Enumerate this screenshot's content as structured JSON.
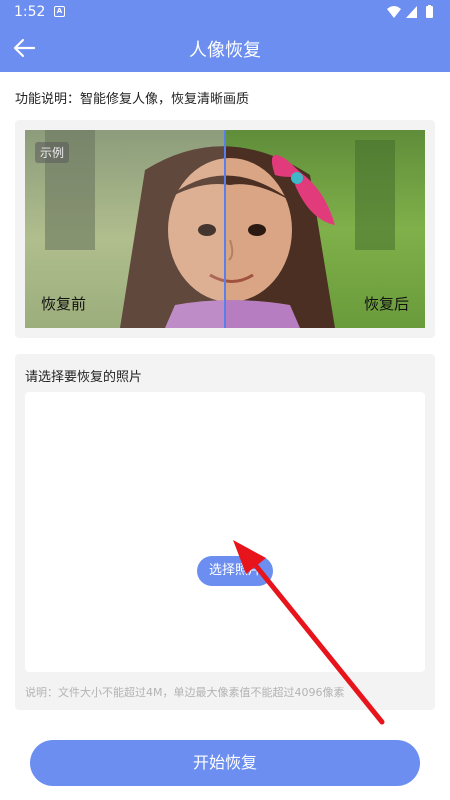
{
  "status": {
    "time": "1:52",
    "notif_icon": "A"
  },
  "appbar": {
    "title": "人像恢复",
    "back_icon": "arrow-left-icon"
  },
  "description": "功能说明：智能修复人像，恢复清晰画质",
  "example": {
    "badge": "示例",
    "before_label": "恢复前",
    "after_label": "恢复后"
  },
  "select": {
    "title": "请选择要恢复的照片",
    "choose_button": "选择照片",
    "note": "说明：文件大小不能超过4M，单边最大像素值不能超过4096像素"
  },
  "start_button": "开始恢复",
  "colors": {
    "primary": "#6b8ef0",
    "card_bg": "#f3f3f3",
    "annotation_arrow": "#e8141c"
  }
}
